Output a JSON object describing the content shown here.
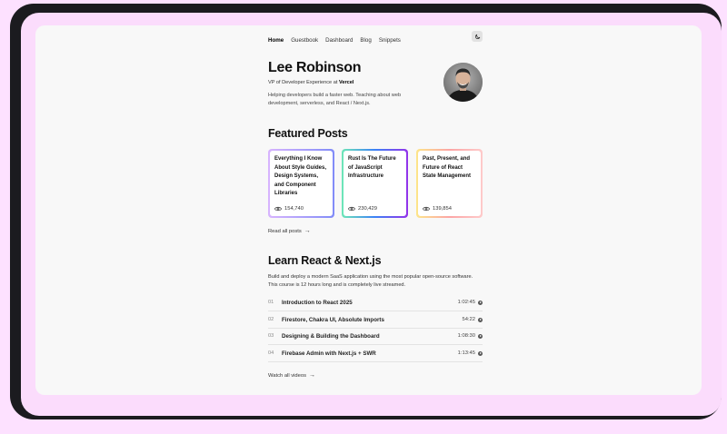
{
  "nav": {
    "items": [
      {
        "label": "Home",
        "active": true
      },
      {
        "label": "Guestbook",
        "active": false
      },
      {
        "label": "Dashboard",
        "active": false
      },
      {
        "label": "Blog",
        "active": false
      },
      {
        "label": "Snippets",
        "active": false
      }
    ],
    "theme_icon": "moon-icon"
  },
  "profile": {
    "name": "Lee Robinson",
    "role_prefix": "VP of Developer Experience at",
    "company": "Vercel",
    "bio": "Helping developers build a faster web. Teaching about web development, serverless, and React / Next.js."
  },
  "featured": {
    "heading": "Featured Posts",
    "posts": [
      {
        "title": "Everything I Know About Style Guides, Design Systems, and Component Libraries",
        "views": "154,740",
        "gradient": [
          "#d8b4fe",
          "#818cf8"
        ]
      },
      {
        "title": "Rust Is The Future of JavaScript Infrastructure",
        "views": "230,429",
        "gradient": [
          "#6ee7b7",
          "#3b82f6",
          "#9333ea"
        ]
      },
      {
        "title": "Past, Present, and Future of React State Management",
        "views": "139,854",
        "gradient": [
          "#fde68a",
          "#fca5a5",
          "#fecaca"
        ]
      }
    ],
    "read_all": "Read all posts"
  },
  "course": {
    "heading": "Learn React & Next.js",
    "description": "Build and deploy a modern SaaS application using the most popular open-source software. This course is 12 hours long and is completely live streamed.",
    "videos": [
      {
        "num": "01",
        "title": "Introduction to React 2025",
        "time": "1:02:45"
      },
      {
        "num": "02",
        "title": "Firestore, Chakra UI, Absolute Imports",
        "time": "54:22"
      },
      {
        "num": "03",
        "title": "Designing & Building the Dashboard",
        "time": "1:08:30"
      },
      {
        "num": "04",
        "title": "Firebase Admin with Next.js + SWR",
        "time": "1:13:45"
      }
    ],
    "watch_all": "Watch all videos"
  }
}
